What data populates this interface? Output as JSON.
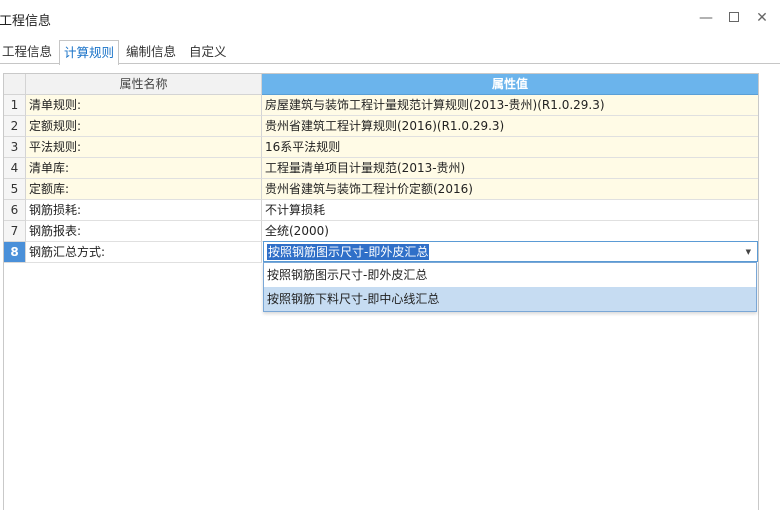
{
  "window": {
    "title": "工程信息",
    "minimize_glyph": "—",
    "close_glyph": "✕"
  },
  "tabs": [
    {
      "label": "工程信息"
    },
    {
      "label": "计算规则"
    },
    {
      "label": "编制信息"
    },
    {
      "label": "自定义"
    }
  ],
  "active_tab": "计算规则",
  "grid": {
    "headers": {
      "name": "属性名称",
      "value": "属性值"
    },
    "rows": [
      {
        "num": "1",
        "name": "清单规则:",
        "value": "房屋建筑与装饰工程计量规范计算规则(2013-贵州)(R1.0.29.3)"
      },
      {
        "num": "2",
        "name": "定额规则:",
        "value": "贵州省建筑工程计算规则(2016)(R1.0.29.3)"
      },
      {
        "num": "3",
        "name": "平法规则:",
        "value": "16系平法规则"
      },
      {
        "num": "4",
        "name": "清单库:",
        "value": "工程量清单项目计量规范(2013-贵州)"
      },
      {
        "num": "5",
        "name": "定额库:",
        "value": "贵州省建筑与装饰工程计价定额(2016)"
      },
      {
        "num": "6",
        "name": "钢筋损耗:",
        "value": "不计算损耗"
      },
      {
        "num": "7",
        "name": "钢筋报表:",
        "value": "全统(2000)"
      },
      {
        "num": "8",
        "name": "钢筋汇总方式:",
        "value": "按照钢筋图示尺寸-即外皮汇总"
      }
    ]
  },
  "dropdown": {
    "options": [
      "按照钢筋图示尺寸-即外皮汇总",
      "按照钢筋下料尺寸-即中心线汇总"
    ],
    "highlighted": "按照钢筋下料尺寸-即中心线汇总"
  },
  "colors": {
    "header_value_bg": "#6bb4ec",
    "selection": "#2f6fc8",
    "row_highlight": "#fffbe6",
    "active_tab_text": "#1a73c8"
  }
}
